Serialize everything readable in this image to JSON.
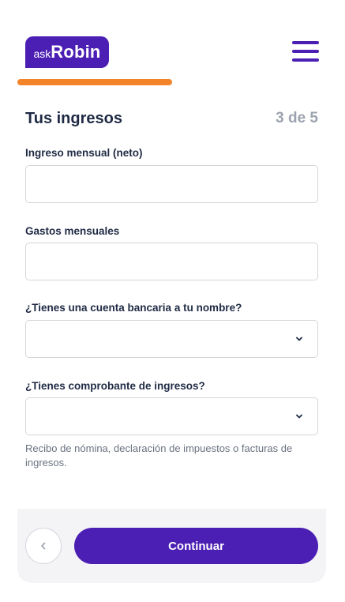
{
  "header": {
    "logo_prefix": "ask",
    "logo_name": "Robin",
    "menu_icon": "hamburger-menu-icon"
  },
  "progress": {
    "fraction": 0.6,
    "color": "#f4842a"
  },
  "form": {
    "title": "Tus ingresos",
    "step": "3 de 5",
    "fields": [
      {
        "label": "Ingreso mensual (neto)",
        "value": "",
        "placeholder": ""
      },
      {
        "label": "Gastos mensuales",
        "value": "",
        "placeholder": ""
      }
    ],
    "selects": [
      {
        "label": "¿Tienes una cuenta bancaria a tu nombre?",
        "value": ""
      },
      {
        "label": "¿Tienes comprobante de ingresos?",
        "value": ""
      }
    ],
    "helper": "Recibo de nómina, declaración de impuestos o facturas de ingresos."
  },
  "footer": {
    "back_icon": "chevron-left-icon",
    "continue_label": "Continuar"
  },
  "colors": {
    "brand": "#4b1fb3",
    "accent": "#f4842a",
    "muted": "#9ca3af"
  }
}
